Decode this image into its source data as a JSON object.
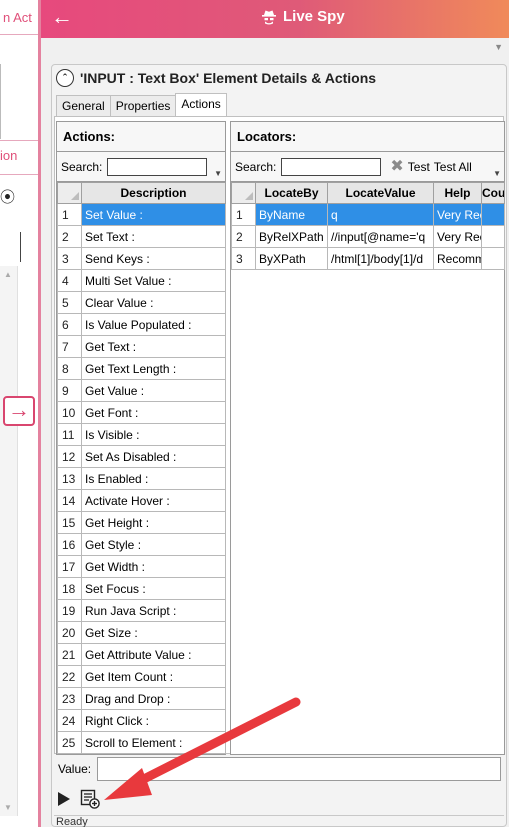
{
  "left_strip": {
    "text_top": "n Act",
    "text_mid": "ion",
    "expand_arrow_icon": "arrow-right-icon"
  },
  "window": {
    "title": "Live Spy",
    "back_icon": "arrow-left-icon",
    "title_icon": "spy-icon",
    "accent_colors": [
      "#e7497d",
      "#f08a5a"
    ]
  },
  "element_details": {
    "title": "'INPUT : Text Box' Element Details & Actions",
    "tabs": [
      "General",
      "Properties",
      "Actions"
    ],
    "active_tab": "Actions"
  },
  "actions": {
    "header": "Actions:",
    "search_label": "Search:",
    "search_value": "",
    "column": "Description",
    "rows": [
      {
        "n": "1",
        "d": "Set Value :"
      },
      {
        "n": "2",
        "d": "Set Text :"
      },
      {
        "n": "3",
        "d": "Send Keys :"
      },
      {
        "n": "4",
        "d": "Multi Set Value :"
      },
      {
        "n": "5",
        "d": "Clear Value :"
      },
      {
        "n": "6",
        "d": "Is Value Populated :"
      },
      {
        "n": "7",
        "d": "Get Text :"
      },
      {
        "n": "8",
        "d": "Get Text Length :"
      },
      {
        "n": "9",
        "d": "Get Value :"
      },
      {
        "n": "10",
        "d": "Get Font :"
      },
      {
        "n": "11",
        "d": "Is Visible :"
      },
      {
        "n": "12",
        "d": "Set As Disabled :"
      },
      {
        "n": "13",
        "d": "Is Enabled :"
      },
      {
        "n": "14",
        "d": "Activate Hover :"
      },
      {
        "n": "15",
        "d": "Get Height :"
      },
      {
        "n": "16",
        "d": "Get Style :"
      },
      {
        "n": "17",
        "d": "Get Width :"
      },
      {
        "n": "18",
        "d": "Set Focus :"
      },
      {
        "n": "19",
        "d": "Run Java Script :"
      },
      {
        "n": "20",
        "d": "Get Size :"
      },
      {
        "n": "21",
        "d": "Get Attribute Value :"
      },
      {
        "n": "22",
        "d": "Get Item Count :"
      },
      {
        "n": "23",
        "d": "Drag and Drop :"
      },
      {
        "n": "24",
        "d": "Right Click :"
      },
      {
        "n": "25",
        "d": "Scroll to Element :"
      }
    ],
    "selected_row": 0
  },
  "locators": {
    "header": "Locators:",
    "search_label": "Search:",
    "search_value": "",
    "test_label": "Test",
    "test_all_label": "Test All",
    "columns": [
      "LocateBy",
      "LocateValue",
      "Help",
      "Cou"
    ],
    "rows": [
      {
        "n": "1",
        "by": "ByName",
        "value": "q",
        "help": "Very Rec",
        "count": ""
      },
      {
        "n": "2",
        "by": "ByRelXPath",
        "value": "//input[@name='q",
        "help": "Very Rec",
        "count": ""
      },
      {
        "n": "3",
        "by": "ByXPath",
        "value": "/html[1]/body[1]/d",
        "help": "Recomm",
        "count": ""
      }
    ],
    "selected_row": 0
  },
  "value_field": {
    "label": "Value:",
    "value": ""
  },
  "run": {
    "play_icon": "play-icon",
    "add_icon": "list-add-icon"
  },
  "status_text": "Ready",
  "annotation": {
    "shape": "arrow",
    "color": "#e8393d"
  }
}
